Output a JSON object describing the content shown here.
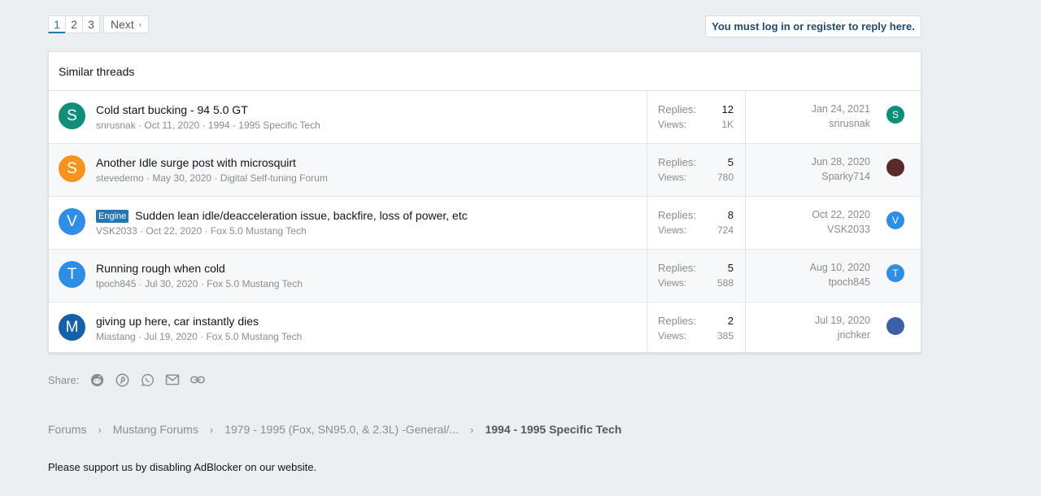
{
  "pagination": {
    "pages": [
      "1",
      "2",
      "3"
    ],
    "current": "1",
    "next_label": "Next",
    "next_arrow": "›"
  },
  "login_notice": "You must log in or register to reply here.",
  "similar": {
    "heading": "Similar threads",
    "replies_label": "Replies:",
    "views_label": "Views:",
    "threads": [
      {
        "avatar_letter": "S",
        "avatar_color": "#0f8f7a",
        "prefix": "",
        "title": "Cold start bucking - 94 5.0 GT",
        "author": "snrusnak",
        "date": "Oct 11, 2020",
        "forum": "1994 - 1995 Specific Tech",
        "replies": "12",
        "views": "1K",
        "last_date": "Jan 24, 2021",
        "last_user": "snrusnak",
        "last_avatar_letter": "S",
        "last_avatar_color": "#0f8f7a"
      },
      {
        "avatar_letter": "S",
        "avatar_color": "#f7941d",
        "prefix": "",
        "title": "Another Idle surge post with microsquirt",
        "author": "stevedemo",
        "date": "May 30, 2020",
        "forum": "Digital Self-tuning Forum",
        "replies": "5",
        "views": "780",
        "last_date": "Jun 28, 2020",
        "last_user": "Sparky714",
        "last_avatar_letter": "",
        "last_avatar_color": "#5a2a2a"
      },
      {
        "avatar_letter": "V",
        "avatar_color": "#2e8ee6",
        "prefix": "Engine",
        "title": "Sudden lean idle/deacceleration issue, backfire, loss of power, etc",
        "author": "VSK2033",
        "date": "Oct 22, 2020",
        "forum": "Fox 5.0 Mustang Tech",
        "replies": "8",
        "views": "724",
        "last_date": "Oct 22, 2020",
        "last_user": "VSK2033",
        "last_avatar_letter": "V",
        "last_avatar_color": "#2e8ee6"
      },
      {
        "avatar_letter": "T",
        "avatar_color": "#2e8ee6",
        "prefix": "",
        "title": "Running rough when cold",
        "author": "tpoch845",
        "date": "Jul 30, 2020",
        "forum": "Fox 5.0 Mustang Tech",
        "replies": "5",
        "views": "588",
        "last_date": "Aug 10, 2020",
        "last_user": "tpoch845",
        "last_avatar_letter": "T",
        "last_avatar_color": "#2e8ee6"
      },
      {
        "avatar_letter": "M",
        "avatar_color": "#1561a8",
        "prefix": "",
        "title": "giving up here, car instantly dies",
        "author": "Miastang",
        "date": "Jul 19, 2020",
        "forum": "Fox 5.0 Mustang Tech",
        "replies": "2",
        "views": "385",
        "last_date": "Jul 19, 2020",
        "last_user": "jrichker",
        "last_avatar_letter": "",
        "last_avatar_color": "#3b5fa8"
      }
    ]
  },
  "share": {
    "label": "Share:",
    "icons": [
      "reddit-icon",
      "pinterest-icon",
      "whatsapp-icon",
      "email-icon",
      "link-icon"
    ]
  },
  "breadcrumbs": {
    "items": [
      "Forums",
      "Mustang Forums",
      "1979 - 1995 (Fox, SN95.0, & 2.3L) -General/..."
    ],
    "current": "1994 - 1995 Specific Tech"
  },
  "ad_notice": "Please support us by disabling AdBlocker on our website."
}
